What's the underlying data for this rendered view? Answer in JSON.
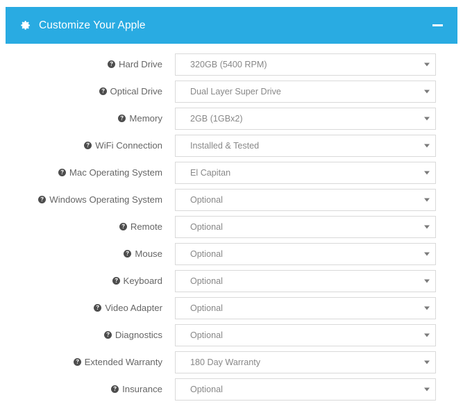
{
  "panel": {
    "title": "Customize Your Apple",
    "gear_icon": "gear-icon",
    "minimize_icon": "minimize-icon",
    "header_color": "#29abe2",
    "header_text_color": "#ffffff"
  },
  "form": {
    "help_icon": "question-circle-icon",
    "caret_icon": "chevron-down-icon",
    "label_color": "#666666",
    "value_color": "#888888",
    "border_color": "#d9d9d9",
    "rows": [
      {
        "label": "Hard Drive",
        "value": "320GB (5400 RPM)"
      },
      {
        "label": "Optical Drive",
        "value": "Dual Layer Super Drive"
      },
      {
        "label": "Memory",
        "value": "2GB (1GBx2)"
      },
      {
        "label": "WiFi Connection",
        "value": "Installed & Tested"
      },
      {
        "label": "Mac Operating System",
        "value": "El Capitan"
      },
      {
        "label": "Windows Operating System",
        "value": "Optional"
      },
      {
        "label": "Remote",
        "value": "Optional"
      },
      {
        "label": "Mouse",
        "value": "Optional"
      },
      {
        "label": "Keyboard",
        "value": "Optional"
      },
      {
        "label": "Video Adapter",
        "value": "Optional"
      },
      {
        "label": "Diagnostics",
        "value": "Optional"
      },
      {
        "label": "Extended Warranty",
        "value": "180 Day Warranty"
      },
      {
        "label": "Insurance",
        "value": "Optional"
      }
    ]
  }
}
